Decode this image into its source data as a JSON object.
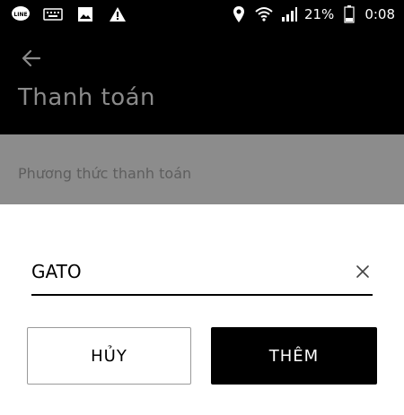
{
  "status_bar": {
    "left_icons": [
      "line-app-icon",
      "keyboard-icon",
      "image-icon",
      "warning-icon"
    ],
    "right_icons": [
      "location-icon",
      "wifi-icon",
      "signal-icon",
      "battery-icon"
    ],
    "battery": "21%",
    "time": "0:08"
  },
  "app_bar": {
    "back_icon": "arrow-left-icon",
    "title": "Thanh toán"
  },
  "section": {
    "label": "Phương thức thanh toán"
  },
  "dialog": {
    "input_value": "GATO",
    "clear_icon": "close-icon",
    "cancel_label": "HỦY",
    "add_label": "THÊM"
  },
  "colors": {
    "status_bg": "#000000",
    "appbar_bg": "#000000",
    "title_color": "#8a8a8a",
    "section_bg": "#8c8c8c",
    "sheet_bg": "#ffffff",
    "primary_button_bg": "#000000"
  }
}
